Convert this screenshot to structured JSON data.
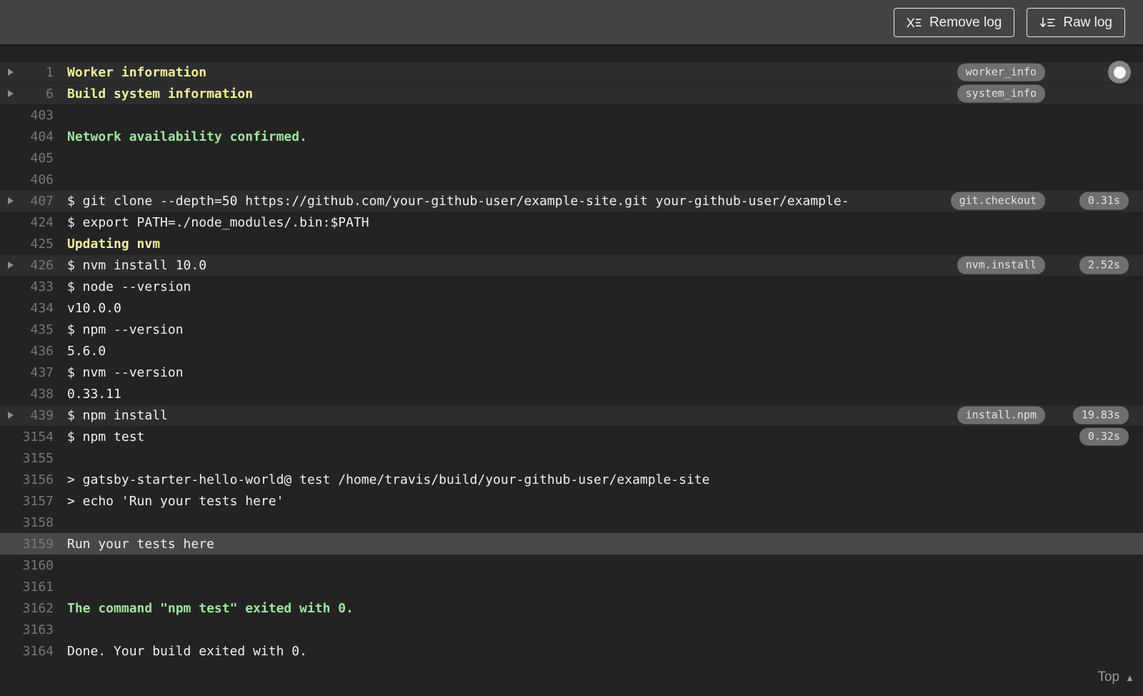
{
  "header": {
    "remove_log_label": "Remove log",
    "raw_log_label": "Raw log"
  },
  "footer": {
    "top_label": "Top"
  },
  "icons": {
    "remove_log": "x-with-list-lines",
    "raw_log": "arrow-down-with-list-lines",
    "fold_arrow": "right-triangle",
    "top": "up-triangle",
    "scroll_indicator": "circle-dot"
  },
  "colors": {
    "toolbar_bg": "#434343",
    "log_bg": "#232323",
    "fold_row_bg": "#2d2d2d",
    "highlight_row_bg": "#484848",
    "line_number": "#777777",
    "log_text": "#f1f1f1",
    "section_yellow": "#f2ef9d",
    "status_green": "#9fe59f",
    "badge_bg": "#6f6f6f",
    "badge_text": "#e5e5e5"
  },
  "log": {
    "rows": [
      {
        "num": "1",
        "text": "Worker information",
        "style": "yellow",
        "fold": true,
        "tag": "worker_info"
      },
      {
        "num": "6",
        "text": "Build system information",
        "style": "yellow",
        "fold": true,
        "tag": "system_info"
      },
      {
        "num": "403",
        "text": ""
      },
      {
        "num": "404",
        "text": "Network availability confirmed.",
        "style": "green"
      },
      {
        "num": "405",
        "text": ""
      },
      {
        "num": "406",
        "text": ""
      },
      {
        "num": "407",
        "text": "$ git clone --depth=50 https://github.com/your-github-user/example-site.git your-github-user/example-",
        "fold": true,
        "tag": "git.checkout",
        "time": "0.31s"
      },
      {
        "num": "424",
        "text": "$ export PATH=./node_modules/.bin:$PATH"
      },
      {
        "num": "425",
        "text": "Updating nvm",
        "style": "yellow"
      },
      {
        "num": "426",
        "text": "$ nvm install 10.0",
        "fold": true,
        "tag": "nvm.install",
        "time": "2.52s"
      },
      {
        "num": "433",
        "text": "$ node --version"
      },
      {
        "num": "434",
        "text": "v10.0.0"
      },
      {
        "num": "435",
        "text": "$ npm --version"
      },
      {
        "num": "436",
        "text": "5.6.0"
      },
      {
        "num": "437",
        "text": "$ nvm --version"
      },
      {
        "num": "438",
        "text": "0.33.11"
      },
      {
        "num": "439",
        "text": "$ npm install",
        "fold": true,
        "tag": "install.npm",
        "time": "19.83s"
      },
      {
        "num": "3154",
        "text": "$ npm test",
        "time": "0.32s"
      },
      {
        "num": "3155",
        "text": ""
      },
      {
        "num": "3156",
        "text": "> gatsby-starter-hello-world@ test /home/travis/build/your-github-user/example-site"
      },
      {
        "num": "3157",
        "text": "> echo 'Run your tests here'"
      },
      {
        "num": "3158",
        "text": ""
      },
      {
        "num": "3159",
        "text": "Run your tests here",
        "highlight": true
      },
      {
        "num": "3160",
        "text": ""
      },
      {
        "num": "3161",
        "text": ""
      },
      {
        "num": "3162",
        "text": "The command \"npm test\" exited with 0.",
        "style": "green"
      },
      {
        "num": "3163",
        "text": ""
      },
      {
        "num": "3164",
        "text": "Done. Your build exited with 0."
      }
    ]
  }
}
